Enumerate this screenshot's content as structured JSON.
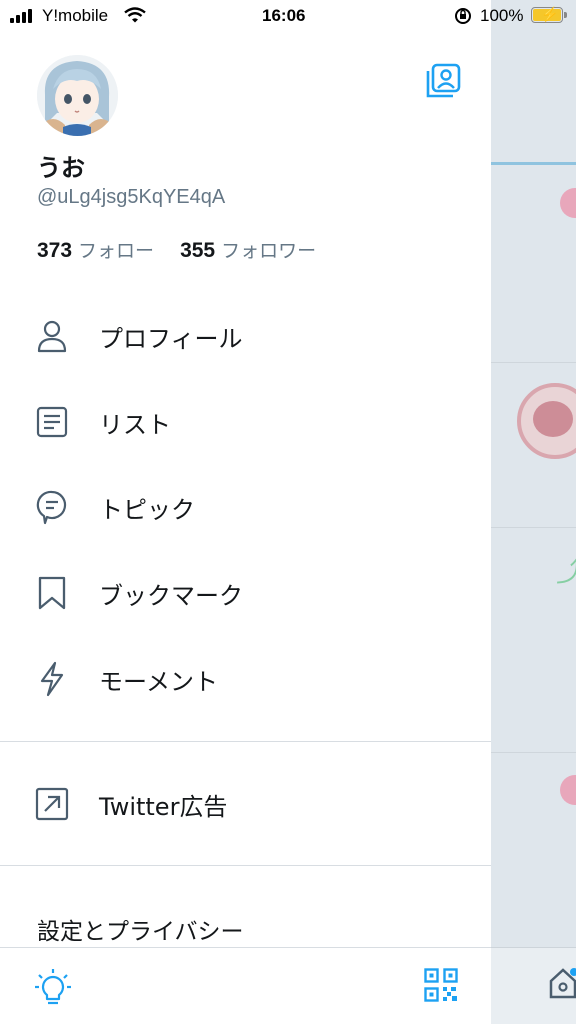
{
  "status_bar": {
    "carrier": "Y!mobile",
    "time": "16:06",
    "battery_percent": "100%"
  },
  "profile": {
    "display_name": "うお",
    "handle": "@uLg4jsg5KqYE4qA",
    "following_count": "373",
    "following_label": "フォロー",
    "followers_count": "355",
    "followers_label": "フォロワー"
  },
  "menu": {
    "items": [
      {
        "label": "プロフィール",
        "icon": "person-icon"
      },
      {
        "label": "リスト",
        "icon": "list-icon"
      },
      {
        "label": "トピック",
        "icon": "topic-bubble-icon"
      },
      {
        "label": "ブックマーク",
        "icon": "bookmark-icon"
      },
      {
        "label": "モーメント",
        "icon": "lightning-icon"
      }
    ],
    "ads_label": "Twitter広告",
    "settings_label": "設定とプライバシー"
  },
  "colors": {
    "accent": "#1da1f2",
    "icon_gray": "#4a5d6e",
    "secondary_text": "#657786"
  }
}
